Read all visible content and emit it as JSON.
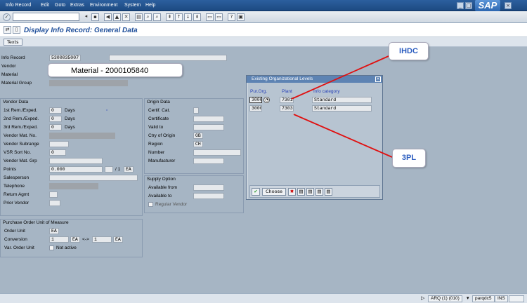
{
  "menu": [
    "Info Record",
    "Edit",
    "Goto",
    "Extras",
    "Environment",
    "System",
    "Help"
  ],
  "sap_logo": "SAP",
  "page_title": "Display Info Record: General Data",
  "app_toolbar": {
    "texts_button": "Texts"
  },
  "header": {
    "info_record_label": "Info Record",
    "info_record_value": "5300035007",
    "vendor_label": "Vendor",
    "material_label": "Material",
    "material_group_label": "Material Group",
    "material_tooltip": "Material - 2000105840"
  },
  "vendor_data": {
    "title": "Vendor Data",
    "first_rem_label": "1st Rem./Exped.",
    "first_rem_value": "0",
    "second_rem_label": "2nd Rem./Exped.",
    "second_rem_value": "0",
    "third_rem_label": "3rd Rem./Exped.",
    "third_rem_value": "0",
    "days": "Days",
    "vendor_mat_no_label": "Vendor Mat. No.",
    "vendor_subrange_label": "Vendor Subrange",
    "vsr_sort_no_label": "VSR Sort No.",
    "vsr_sort_no_value": "0",
    "vendor_mat_grp_label": "Vendor Mat. Grp",
    "points_label": "Points",
    "points_value": "0.000",
    "points_per": "/ 1",
    "points_unit": "EA",
    "salesperson_label": "Salesperson",
    "telephone_label": "Telephone",
    "return_agmt_label": "Return Agmt",
    "prior_vendor_label": "Prior Vendor"
  },
  "origin_data": {
    "title": "Origin Data",
    "certif_cat_label": "Certif. Cat.",
    "certificate_label": "Certificate",
    "valid_to_label": "Valid to",
    "ctry_origin_label": "Ctry of Origin",
    "ctry_origin_value": "GB",
    "region_label": "Region",
    "region_value": "CH",
    "number_label": "Number",
    "manufacturer_label": "Manufacturer"
  },
  "supply_option": {
    "title": "Supply Option",
    "available_from_label": "Available from",
    "available_to_label": "Available to",
    "regular_vendor_label": "Regular Vendor"
  },
  "purchase_uom": {
    "title": "Purchase Order Unit of Measure",
    "order_unit_label": "Order Unit",
    "order_unit_value": "EA",
    "conversion_label": "Conversion",
    "conv_left_qty": "1",
    "conv_left_unit": "EA",
    "conv_arrow": "<->",
    "conv_right_qty": "1",
    "conv_right_unit": "EA",
    "var_order_unit_label": "Var. Order Unit",
    "not_active_label": "Not active"
  },
  "popup": {
    "title": "Existing Organizational Levels",
    "col_purorg": "Pur.Org.",
    "col_plant": "Plant",
    "col_info_category": "Info category",
    "rows": [
      {
        "purorg": "3000",
        "plant": "7301",
        "category": "Standard"
      },
      {
        "purorg": "3000",
        "plant": "7303",
        "category": "Standard"
      }
    ],
    "choose_label": "Choose"
  },
  "callouts": {
    "ihdc": "IHDC",
    "threepl": "3PL"
  },
  "status": {
    "system": "ARQ (1) (010)",
    "server": "parqdc5",
    "mode": "INS"
  },
  "colors": {
    "menubar": "#1d4a82",
    "title": "#1f4f9a",
    "callout_line": "#e01010",
    "column_header": "#2b44b8"
  }
}
